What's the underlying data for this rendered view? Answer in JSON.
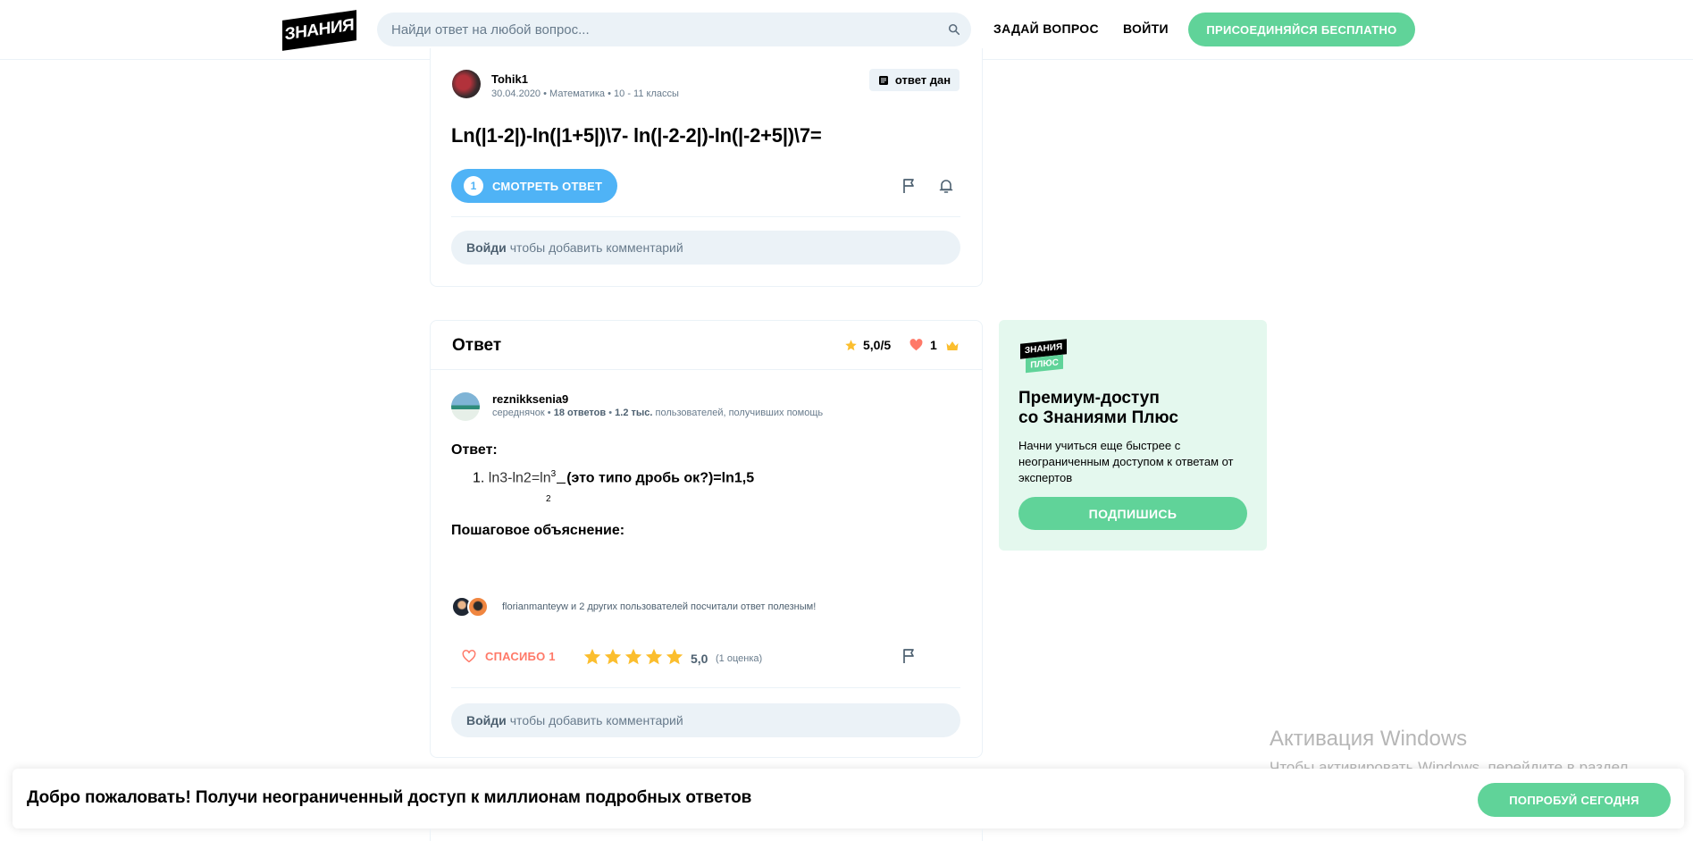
{
  "header": {
    "logo_text": "ЗНАНИЯ",
    "search_placeholder": "Найди ответ на любой вопрос...",
    "ask_label": "ЗАДАЙ ВОПРОС",
    "login_label": "ВОЙТИ",
    "join_label": "ПРИСОЕДИНЯЙСЯ БЕСПЛАТНО"
  },
  "question": {
    "author": "Tohik1",
    "date": "30.04.2020",
    "subject": "Математика",
    "grade": "10 - 11 классы",
    "badge": "ответ дан",
    "text": "Ln(|1-2|)-ln(|1+5|)\\7- ln(|-2-2|)-ln(|-2+5|)\\7=",
    "answers_count": "1",
    "view_answer_label": "СМОТРЕТЬ ОТВЕТ",
    "comment_login": "Войди",
    "comment_text": "чтобы добавить комментарий"
  },
  "answer": {
    "title": "Ответ",
    "rating": "5,0/5",
    "likes": "1",
    "author": "reznikksenia9",
    "rank": "середнячок",
    "answers_count": "18 ответов",
    "helped_count": "1.2 тыс.",
    "helped_text": "пользователей, получивших помощь",
    "answer_label": "Ответ:",
    "list_number": "1.",
    "line_plain": "ln3-ln2=ln",
    "frac_num": "3",
    "frac_den": "2",
    "line_bold": "(это типо дробь ок?)=ln1,5",
    "explanation_label": "Пошаговое объяснение:",
    "useful_text": "florianmanteyw и 2 других пользователей посчитали ответ полезным!",
    "thanks_label": "СПАСИБО 1",
    "score": "5,0",
    "score_count": "(1 оценка)",
    "stars": 5,
    "comment_login": "Войди",
    "comment_text": "чтобы добавить комментарий"
  },
  "promo": {
    "logo_line1": "ЗНАНИЯ",
    "logo_line2": "ПЛЮС",
    "title_line1": "Премиум-доступ",
    "title_line2": "со Знаниями Плюс",
    "text": "Начни учиться еще быстрее с неограниченным доступом к ответам от экспертов",
    "button": "ПОДПИШИСЬ"
  },
  "banner": {
    "text": "Добро пожаловать! Получи неограниченный доступ к миллионам подробных ответов",
    "button": "ПОПРОБУЙ СЕГОДНЯ"
  },
  "windows": {
    "title": "Активация Windows",
    "text": "Чтобы активировать Windows, перейдите в раздел \"Параметры\"."
  },
  "colors": {
    "accent_green": "#60d399",
    "accent_blue": "#4fb3f6",
    "thanks_red": "#ff7968",
    "star_yellow": "#fbbe2e",
    "surface": "#ebf2f7"
  }
}
